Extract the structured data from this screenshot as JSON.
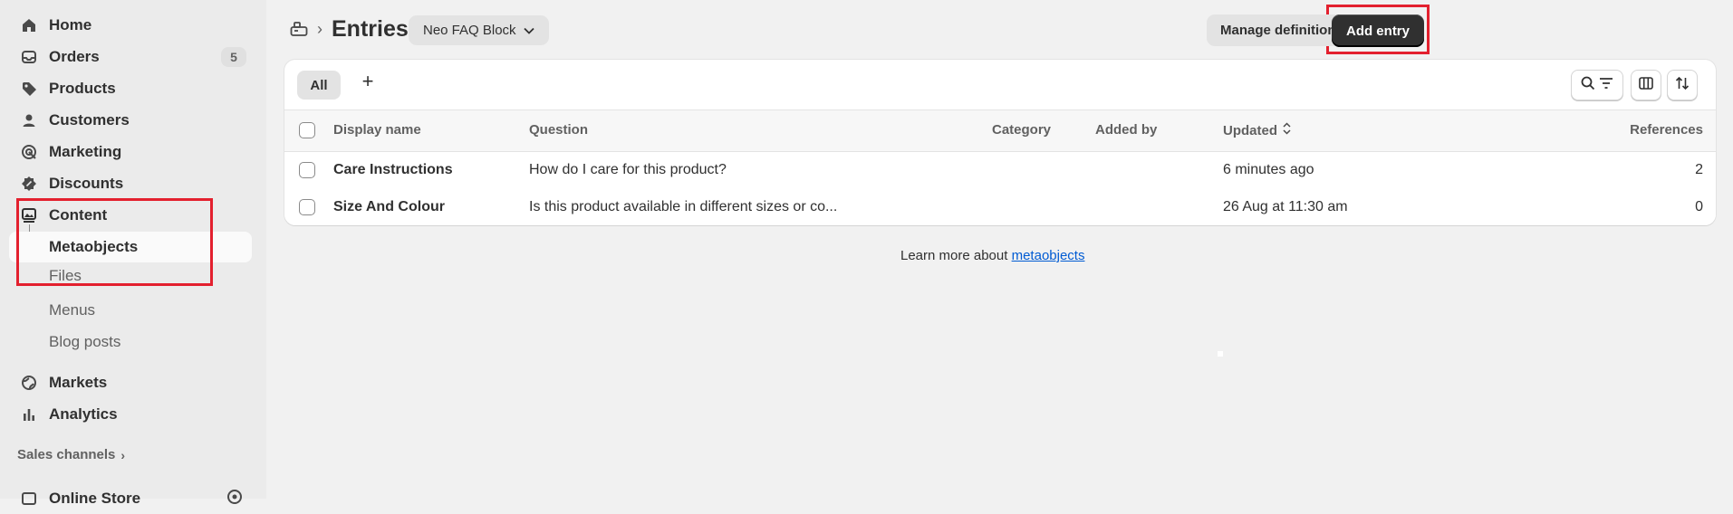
{
  "sidebar": {
    "items": [
      {
        "label": "Home",
        "icon": "home-icon"
      },
      {
        "label": "Orders",
        "icon": "inbox-icon",
        "badge": "5"
      },
      {
        "label": "Products",
        "icon": "tag-icon"
      },
      {
        "label": "Customers",
        "icon": "person-icon"
      },
      {
        "label": "Marketing",
        "icon": "target-icon"
      },
      {
        "label": "Discounts",
        "icon": "discount-icon"
      },
      {
        "label": "Content",
        "icon": "image-icon"
      }
    ],
    "content_sub": [
      {
        "label": "Metaobjects",
        "active": true
      },
      {
        "label": "Files"
      },
      {
        "label": "Menus"
      },
      {
        "label": "Blog posts"
      }
    ],
    "lower_items": [
      {
        "label": "Markets",
        "icon": "globe-icon"
      },
      {
        "label": "Analytics",
        "icon": "bar-chart-icon"
      }
    ],
    "sales_channels_label": "Sales channels",
    "online_store_label": "Online Store"
  },
  "header": {
    "title": "Entries",
    "definition_select": "Neo FAQ Block",
    "manage_definition": "Manage definition",
    "add_entry": "Add entry"
  },
  "tabs": {
    "all": "All",
    "add": "+"
  },
  "table": {
    "columns": [
      "Display name",
      "Question",
      "Category",
      "Added by",
      "Updated",
      "References"
    ],
    "rows": [
      {
        "display_name": "Care Instructions",
        "question": "How do I care for this product?",
        "category": "",
        "added_by": "",
        "updated": "6 minutes ago",
        "references": "2"
      },
      {
        "display_name": "Size And Colour",
        "question": "Is this product available in different sizes or co...",
        "category": "",
        "added_by": "",
        "updated": "26 Aug at 11:30 am",
        "references": "0"
      }
    ]
  },
  "footer": {
    "text": "Learn more about",
    "link": "metaobjects"
  },
  "colors": {
    "highlight": "#e3202e",
    "primary_button": "#303030",
    "link": "#005bd3"
  }
}
